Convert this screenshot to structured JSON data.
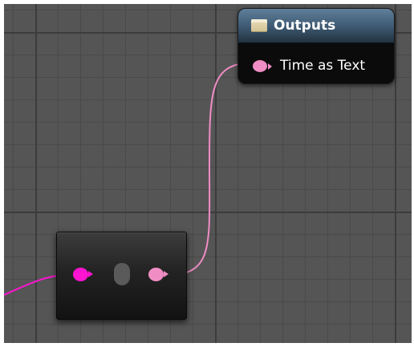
{
  "outputs_node": {
    "title": "Outputs",
    "pin_label": "Time as Text",
    "header_color": "#3d5870",
    "icon": "struct-icon"
  },
  "conversion_node": {
    "input_pin_color": "#ff14d2",
    "output_pin_color": "#f08dc4"
  },
  "colors": {
    "text_pin": "#f08dc4",
    "wire_in": "#ff14d2",
    "wire_out": "#f08dc4",
    "grid_background": "#555555"
  }
}
